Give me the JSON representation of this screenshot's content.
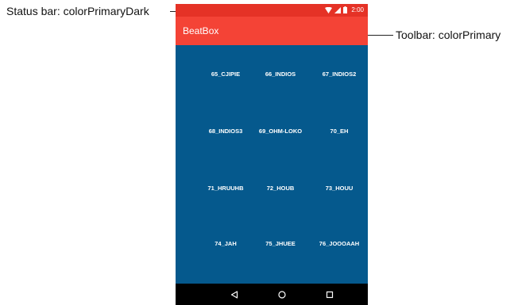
{
  "annotations": {
    "status_bar_label": "Status bar: colorPrimaryDark",
    "toolbar_label": "Toolbar: colorPrimary"
  },
  "status_bar": {
    "time": "2:00",
    "icons": [
      "wifi-icon",
      "signal-icon",
      "battery-icon"
    ]
  },
  "toolbar": {
    "title": "BeatBox"
  },
  "sounds": [
    "65_CJIPIE",
    "66_INDIOS",
    "67_INDIOS2",
    "68_INDIOS3",
    "69_OHM-LOKO",
    "70_EH",
    "71_HRUUHB",
    "72_HOUB",
    "73_HOUU",
    "74_JAH",
    "75_JHUEE",
    "76_JOOOAAH"
  ],
  "nav_bar": {
    "icons": [
      "back-icon",
      "home-icon",
      "recents-icon"
    ]
  },
  "colors": {
    "colorPrimaryDark": "#e53226",
    "colorPrimary": "#f44336",
    "background": "#05598d",
    "nav_bar": "#000000"
  }
}
